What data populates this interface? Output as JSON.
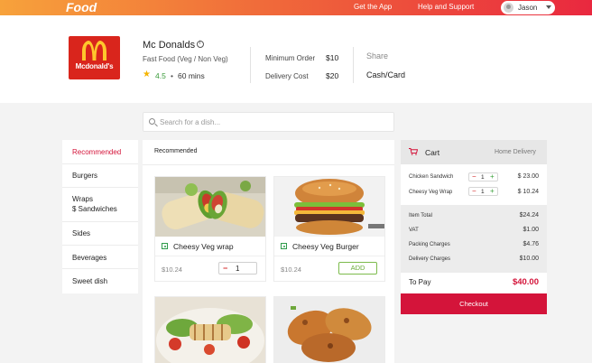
{
  "topbar": {
    "logo": "Food",
    "links": [
      "Get the App",
      "Help and Support"
    ],
    "user": "Jason"
  },
  "restaurant": {
    "logo_text": "Mcdonald's",
    "name": "Mc Donalds",
    "cuisine": "Fast Food (Veg / Non Veg)",
    "rating": "4.5",
    "separator": "•",
    "eta": "60 mins",
    "min_order_label": "Minimum Order",
    "min_order_value": "$10",
    "delivery_label": "Delivery Cost",
    "delivery_value": "$20",
    "share_label": "Share",
    "payment": "Cash/Card",
    "brand_color": "#d9251c"
  },
  "search": {
    "placeholder": "Search for a dish..."
  },
  "categories": [
    {
      "label": "Recommended",
      "active": true
    },
    {
      "label": "Burgers"
    },
    {
      "label": "Wraps\n$ Sandwiches"
    },
    {
      "label": "Sides"
    },
    {
      "label": "Beverages"
    },
    {
      "label": "Sweet dish"
    }
  ],
  "menu": {
    "title": "Recommended",
    "items": [
      {
        "name": "Cheesy Veg wrap",
        "price": "$10.24",
        "qty": "1",
        "veg": true
      },
      {
        "name": "Cheesy Veg Burger",
        "price": "$10.24",
        "add_label": "ADD",
        "veg": true
      },
      {
        "name": "",
        "price": ""
      },
      {
        "name": "",
        "price": ""
      }
    ]
  },
  "cart": {
    "title": "Cart",
    "mode": "Home Delivery",
    "items": [
      {
        "name": "Chicken Sandwich",
        "qty": "1",
        "price": "$ 23.00"
      },
      {
        "name": "Cheesy Veg Wrap",
        "qty": "1",
        "price": "$ 10.24"
      }
    ],
    "charges": [
      {
        "label": "Item Total",
        "value": "$24.24"
      },
      {
        "label": "VAT",
        "value": "$1.00"
      },
      {
        "label": "Packing Charges",
        "value": "$4.76"
      },
      {
        "label": "Delivery Charges",
        "value": "$10.00"
      }
    ],
    "to_pay_label": "To Pay",
    "to_pay_value": "$40.00",
    "checkout_label": "Checkout",
    "accent_color": "#d4143a"
  }
}
